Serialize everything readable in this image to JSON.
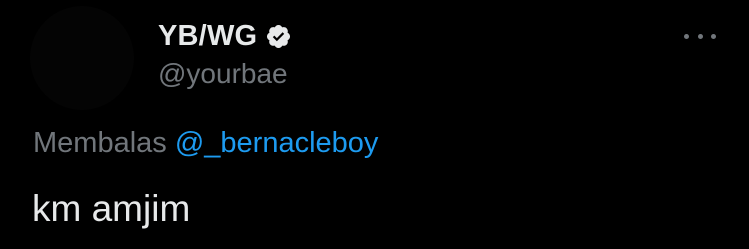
{
  "tweet": {
    "author": {
      "display_name": "YB/WG",
      "handle": "@yourbae",
      "verified_icon": "verified-badge-icon",
      "avatar": "avatar"
    },
    "more_icon": "more-options-icon",
    "reply_to": {
      "prefix": "Membalas",
      "handle": "@_bernacleboy"
    },
    "text": "km amjim"
  },
  "colors": {
    "background": "#000000",
    "primary_text": "#e7e9ea",
    "secondary_text": "#71767b",
    "link": "#1d9bf0"
  }
}
